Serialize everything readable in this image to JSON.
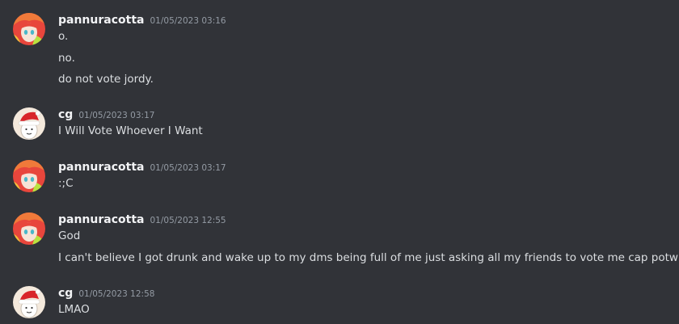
{
  "colors": {
    "background": "#313338",
    "username": "#f2f3f5",
    "timestamp": "#949ba4",
    "message_text": "#dbdee1"
  },
  "groups": [
    {
      "author": "pannuracotta",
      "avatar": "anime-avatar-icon",
      "timestamp": "01/05/2023 03:16",
      "messages": [
        "o.",
        "no.",
        "do not vote jordy."
      ]
    },
    {
      "author": "cg",
      "avatar": "santa-hat-avatar-icon",
      "timestamp": "01/05/2023 03:17",
      "messages": [
        "I Will Vote Whoever I Want"
      ]
    },
    {
      "author": "pannuracotta",
      "avatar": "anime-avatar-icon",
      "timestamp": "01/05/2023 03:17",
      "messages": [
        ":;C"
      ]
    },
    {
      "author": "pannuracotta",
      "avatar": "anime-avatar-icon",
      "timestamp": "01/05/2023 12:55",
      "messages": [
        "God",
        "I can't believe I got drunk and wake up to my dms being full of me just asking all my friends to vote me cap potw"
      ]
    },
    {
      "author": "cg",
      "avatar": "santa-hat-avatar-icon",
      "timestamp": "01/05/2023 12:58",
      "messages": [
        "LMAO"
      ]
    }
  ]
}
